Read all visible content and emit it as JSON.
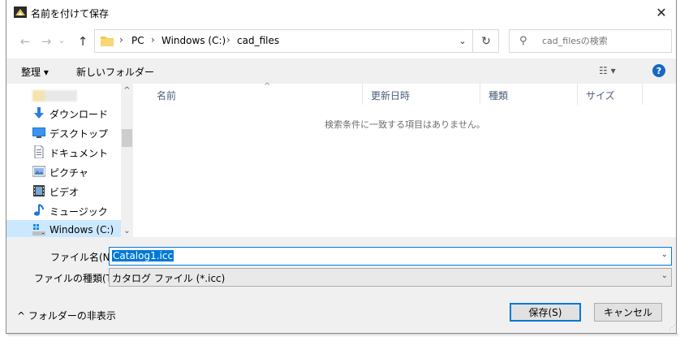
{
  "window": {
    "title": "名前を付けて保存",
    "close_glyph": "✕"
  },
  "nav": {
    "back_glyph": "←",
    "forward_glyph": "→",
    "recent_glyph": "⌄",
    "up_glyph": "↑"
  },
  "address": {
    "crumbs": [
      "PC",
      "Windows (C:)",
      "cad_files"
    ],
    "separator": "›",
    "dropdown_glyph": "⌄",
    "refresh_glyph": "↻"
  },
  "search": {
    "placeholder": "cad_filesの検索",
    "icon_glyph": "⚲"
  },
  "commandbar": {
    "organize": "整理 ▾",
    "new_folder": "新しいフォルダー",
    "view_glyph": "☷ ▾",
    "help_glyph": "?"
  },
  "sidebar": {
    "items": [
      {
        "label": "ダウンロード"
      },
      {
        "label": "デスクトップ"
      },
      {
        "label": "ドキュメント"
      },
      {
        "label": "ピクチャ"
      },
      {
        "label": "ビデオ"
      },
      {
        "label": "ミュージック"
      },
      {
        "label": "Windows (C:)"
      }
    ],
    "scroll_up": "^",
    "scroll_down": "⌄"
  },
  "filelist": {
    "columns": [
      "名前",
      "更新日時",
      "種類",
      "サイズ"
    ],
    "sort_glyph": "^",
    "empty_message": "検索条件に一致する項目はありません。"
  },
  "form": {
    "filename_label": "ファイル名(N):",
    "filename_value": "Catalog1.icc",
    "filetype_label": "ファイルの種類(T):",
    "filetype_value": "カタログ ファイル (*.icc)",
    "caret": "⌄"
  },
  "footer": {
    "toggle_folders": "^  フォルダーの非表示",
    "save_button": "保存(S)",
    "cancel_button": "キャンセル",
    "grip": "⋰"
  },
  "colors": {
    "accent": "#0078d7",
    "selection": "#cce8ff",
    "chrome": "#f0f0f0",
    "header_text": "#4c607a"
  }
}
